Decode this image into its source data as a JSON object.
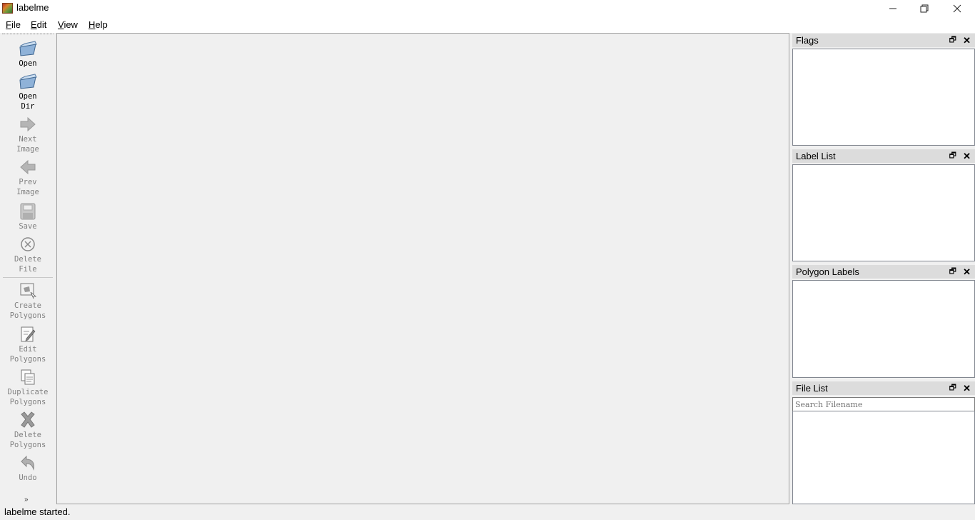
{
  "window": {
    "title": "labelme"
  },
  "menu": [
    "File",
    "Edit",
    "View",
    "Help"
  ],
  "toolbar": {
    "open": "Open",
    "open_dir": "Open\nDir",
    "next_image": "Next\nImage",
    "prev_image": "Prev\nImage",
    "save": "Save",
    "delete_file": "Delete\nFile",
    "create_polygons": "Create\nPolygons",
    "edit_polygons": "Edit\nPolygons",
    "duplicate_polygons": "Duplicate\nPolygons",
    "delete_polygons": "Delete\nPolygons",
    "undo": "Undo",
    "more": "»"
  },
  "docks": {
    "flags": "Flags",
    "label_list": "Label List",
    "polygon_labels": "Polygon Labels",
    "file_list": "File List",
    "search_placeholder": "Search Filename"
  },
  "status": "labelme started."
}
